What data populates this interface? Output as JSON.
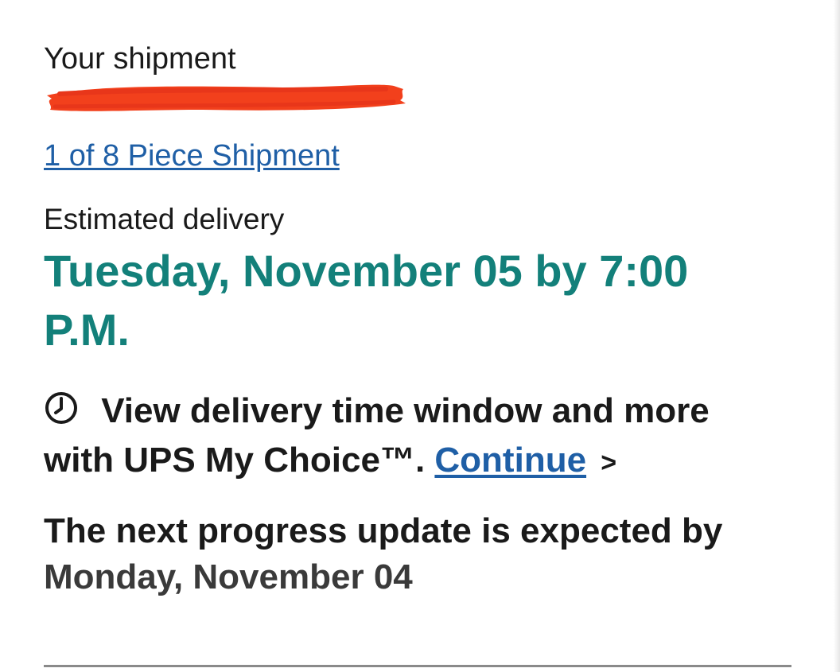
{
  "shipment": {
    "label": "Your shipment",
    "piece_link": "1 of 8 Piece Shipment"
  },
  "delivery": {
    "label": "Estimated delivery",
    "date": "Tuesday, November 05 by 7:00 P.M."
  },
  "my_choice": {
    "text": "View delivery time window and more with UPS My Choice™.",
    "continue_label": "Continue",
    "chevron": ">"
  },
  "progress": {
    "text": "The next progress update is expected by",
    "date": "Monday, November 04"
  },
  "colors": {
    "accent_teal": "#13807a",
    "link_blue": "#1f5fa6",
    "redaction_red": "#f2401c"
  },
  "icons": {
    "clock": "clock-icon",
    "chevron": "chevron-right-icon"
  }
}
